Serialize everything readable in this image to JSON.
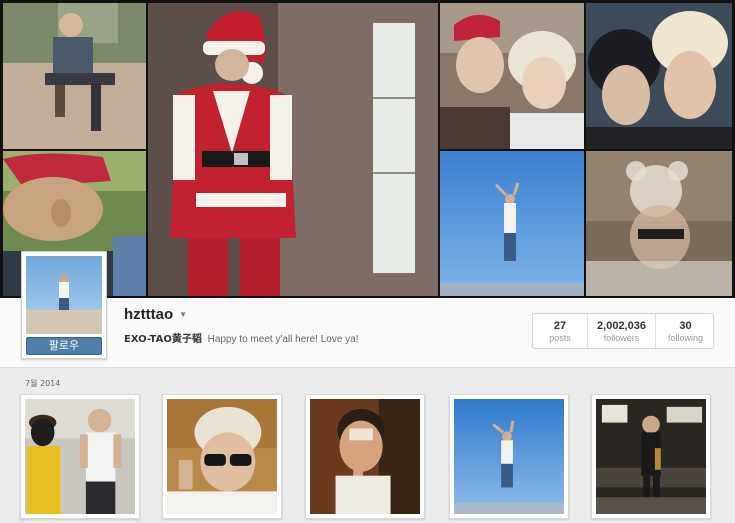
{
  "profile": {
    "username": "hztttao",
    "follow_label": "팔로우",
    "bio_name": "EXO-TAO黄子韬",
    "bio_text": "Happy to meet y'all here! Love ya!"
  },
  "stats": [
    {
      "value": "27",
      "label": "posts"
    },
    {
      "value": "2,002,036",
      "label": "followers"
    },
    {
      "value": "30",
      "label": "following"
    }
  ],
  "section": {
    "month_label": "7월 2014"
  }
}
